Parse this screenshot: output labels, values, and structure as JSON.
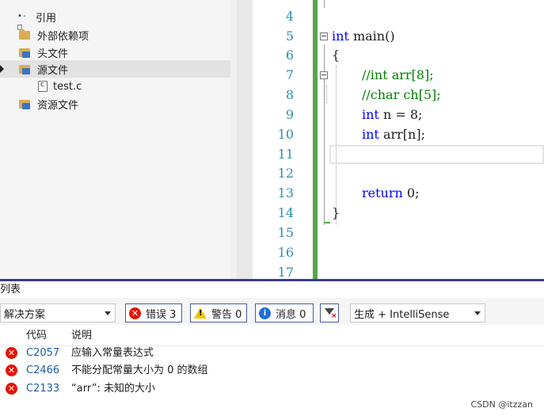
{
  "explorer": {
    "items": [
      {
        "label": "引用",
        "icon": "references-icon"
      },
      {
        "label": "外部依赖项",
        "icon": "folder-icon"
      },
      {
        "label": "头文件",
        "icon": "folder-icon"
      },
      {
        "label": "源文件",
        "icon": "folder-icon"
      },
      {
        "label": "test.c",
        "icon": "c-file-icon"
      },
      {
        "label": "资源文件",
        "icon": "folder-icon"
      }
    ]
  },
  "editor": {
    "line_numbers": [
      "4",
      "5",
      "6",
      "7",
      "8",
      "9",
      "10",
      "11",
      "12",
      "13",
      "14",
      "15",
      "16",
      "17"
    ],
    "code": {
      "l5_kw": "int",
      "l5_rest": " main()",
      "l6": "{",
      "l7": "//int arr[8];",
      "l8": "//char ch[5];",
      "l9_kw": "int",
      "l9_rest": " n = 8;",
      "l10_kw": "int",
      "l10_rest": " arr[n];",
      "l13_kw": "return",
      "l13_rest": " 0;",
      "l14": "}"
    }
  },
  "error_list": {
    "title": "列表",
    "scope": "解决方案",
    "filters": {
      "errors": "错误 3",
      "warnings": "警告 0",
      "messages": "消息 0"
    },
    "build_source": "生成 + IntelliSense",
    "columns": {
      "code": "代码",
      "description": "说明"
    },
    "rows": [
      {
        "code": "C2057",
        "description": "应输入常量表达式"
      },
      {
        "code": "C2466",
        "description": "不能分配常量大小为 0 的数组"
      },
      {
        "code": "C2133",
        "description": "“arr”: 未知的大小"
      }
    ]
  },
  "watermark": "CSDN @itzzan",
  "colors": {
    "keyword": "#0000ff",
    "comment": "#008000",
    "line_number": "#2b91af",
    "error": "#e51400",
    "change_bar": "#57a64a"
  }
}
